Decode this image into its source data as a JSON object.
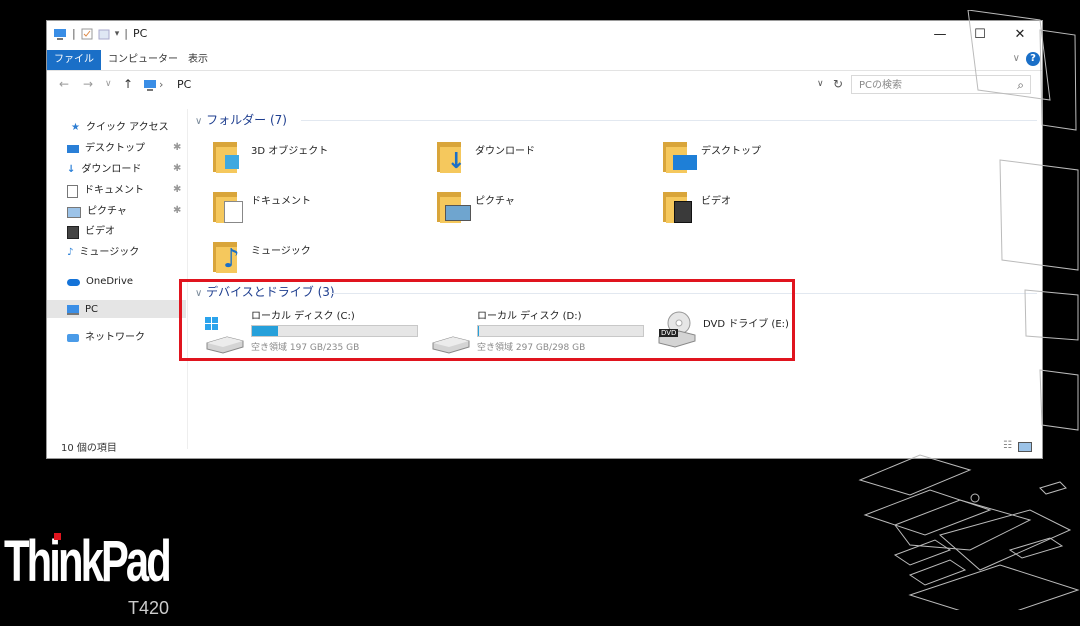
{
  "window": {
    "title": "PC",
    "qat_separator": "|",
    "minimize": "—",
    "maximize": "☐",
    "close": "✕"
  },
  "ribbon": {
    "tabs": [
      {
        "label": "ファイル",
        "active": true
      },
      {
        "label": "コンピューター",
        "active": false
      },
      {
        "label": "表示",
        "active": false
      }
    ],
    "help": "?",
    "collapse": "∨"
  },
  "address": {
    "back": "←",
    "forward": "→",
    "recent": "∨",
    "up": "↑",
    "path": "PC",
    "path_sep": "›",
    "dropdown": "∨",
    "refresh": "↻",
    "search_placeholder": "PCの検索",
    "search_icon": "⌕"
  },
  "sidebar": {
    "quick_access": "クイック アクセス",
    "items": [
      {
        "label": "デスクトップ",
        "pinned": true
      },
      {
        "label": "ダウンロード",
        "pinned": true
      },
      {
        "label": "ドキュメント",
        "pinned": true
      },
      {
        "label": "ピクチャ",
        "pinned": true
      },
      {
        "label": "ビデオ",
        "pinned": false
      },
      {
        "label": "ミュージック",
        "pinned": false
      }
    ],
    "onedrive": "OneDrive",
    "pc": "PC",
    "network": "ネットワーク",
    "pin_glyph": "✱"
  },
  "content": {
    "folders_header": "フォルダー (7)",
    "folders": [
      "3D オブジェクト",
      "ダウンロード",
      "デスクトップ",
      "ドキュメント",
      "ピクチャ",
      "ビデオ",
      "ミュージック"
    ],
    "devices_header": "デバイスとドライブ (3)",
    "group_chevron": "∨",
    "drives": [
      {
        "label": "ローカル ディスク (C:)",
        "free": "空き領域 197 GB/235 GB",
        "used_fraction": 0.16
      },
      {
        "label": "ローカル ディスク (D:)",
        "free": "空き領域 297 GB/298 GB",
        "used_fraction": 0.003
      },
      {
        "label": "DVD ドライブ (E:)"
      }
    ],
    "dvd_badge": "DVD"
  },
  "status": {
    "count": "10 個の項目"
  },
  "branding": {
    "logo": "ThinkPad",
    "model": "T420"
  },
  "colors": {
    "accent": "#1a6fc7",
    "highlight": "#e0141e",
    "folder": "#f5c85d",
    "bar_fill": "#26a0da"
  }
}
